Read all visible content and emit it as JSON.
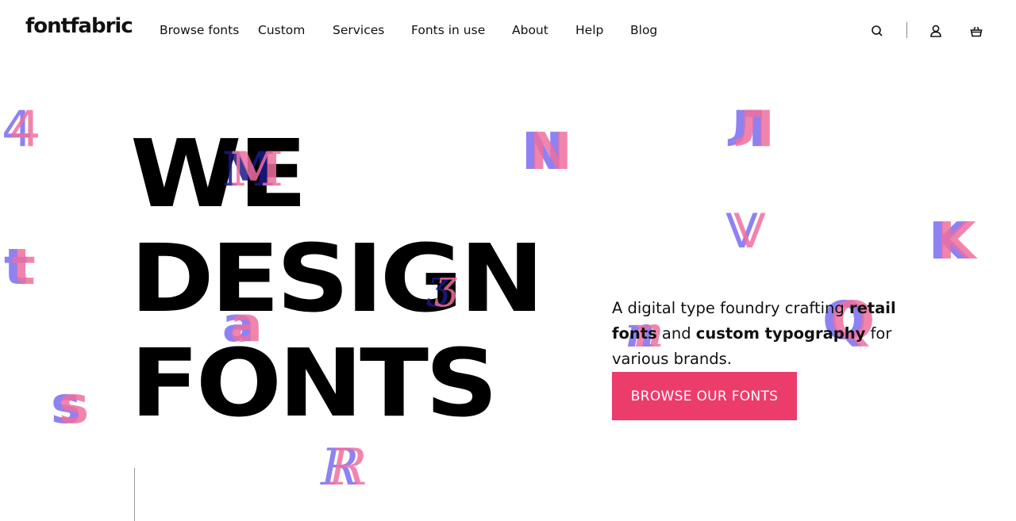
{
  "header": {
    "logo": "fontfabric",
    "nav": [
      "Browse fonts",
      "Custom",
      "Services",
      "Fonts in use",
      "About",
      "Help",
      "Blog"
    ],
    "icons": [
      "search-icon",
      "user-icon",
      "basket-icon"
    ]
  },
  "hero": {
    "headline": [
      "WE",
      "DESIGN",
      "FONTS"
    ],
    "tagline": {
      "part1": "A digital type foundry crafting ",
      "bold1": "retail fonts",
      "part2": " and ",
      "bold2": "custom typography",
      "part3": " for various brands."
    },
    "cta_label": "BROWSE OUR FONTS",
    "decorative_glyphs": [
      "4",
      "M",
      "N",
      "Л",
      "V",
      "K",
      "t",
      "a",
      "ʒ",
      "n",
      "Q",
      "s",
      "R"
    ]
  },
  "colors": {
    "accent": "#ec3c6c",
    "glyph_blue": "#7b6cf0",
    "glyph_pink": "#ef6f9f",
    "text": "#111111"
  }
}
